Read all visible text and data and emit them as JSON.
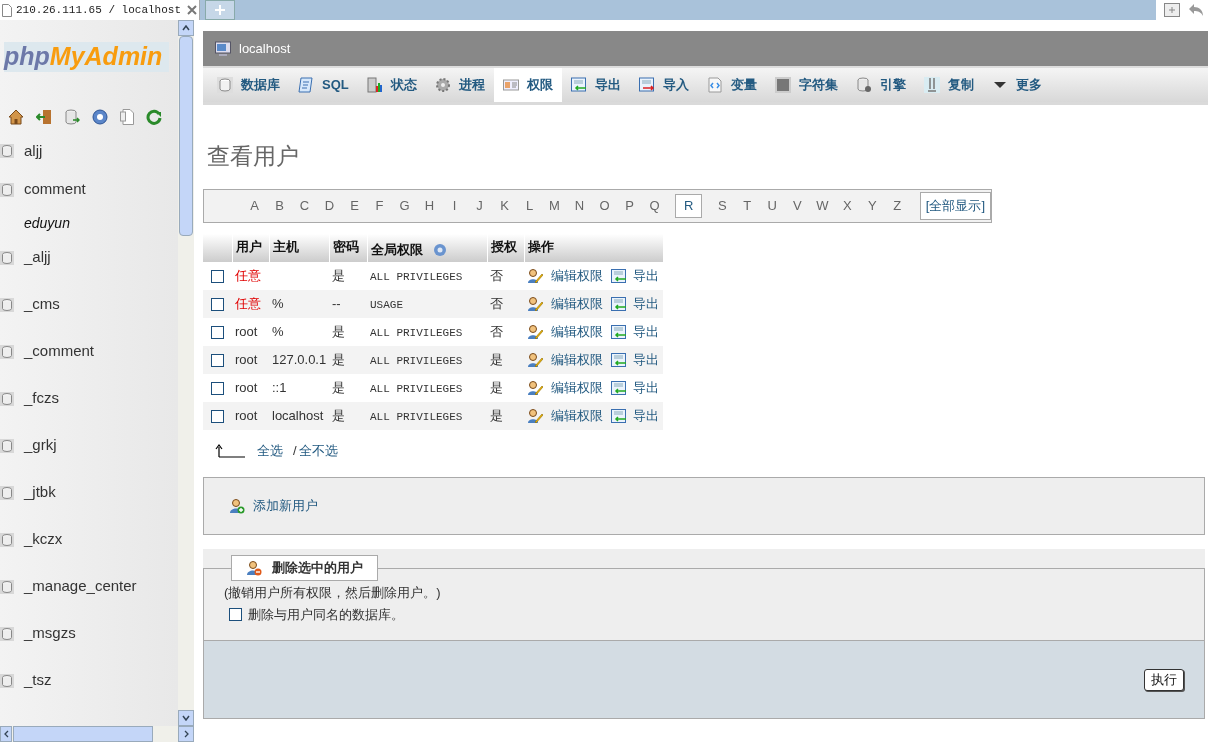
{
  "browser_tab": {
    "title": "210.26.111.65 / localhost"
  },
  "sidebar": {
    "logo": {
      "part_1": "php",
      "part_2": "MyAdmin"
    },
    "items": [
      {
        "name": "aljj"
      },
      {
        "name": "comment"
      },
      {
        "name": "eduyun",
        "children": [
          {
            "name": "_aljj"
          },
          {
            "name": "_cms"
          },
          {
            "name": "_comment"
          },
          {
            "name": "_fczs"
          },
          {
            "name": "_grkj"
          },
          {
            "name": "_jtbk"
          },
          {
            "name": "_kczx"
          },
          {
            "name": "_manage_center"
          },
          {
            "name": "_msgzs"
          },
          {
            "name": "_tsz"
          }
        ]
      }
    ]
  },
  "server": {
    "title": "localhost"
  },
  "nav_tabs": [
    {
      "label": "数据库",
      "selected": false
    },
    {
      "label": "SQL",
      "selected": false
    },
    {
      "label": "状态",
      "selected": false
    },
    {
      "label": "进程",
      "selected": false
    },
    {
      "label": "权限",
      "selected": true
    },
    {
      "label": "导出",
      "selected": false
    },
    {
      "label": "导入",
      "selected": false
    },
    {
      "label": "变量",
      "selected": false
    },
    {
      "label": "字符集",
      "selected": false
    },
    {
      "label": "引擎",
      "selected": false
    },
    {
      "label": "复制",
      "selected": false
    },
    {
      "label": "更多",
      "selected": false
    }
  ],
  "page_title": "查看用户",
  "letters": [
    {
      "label": "A",
      "selected": false
    },
    {
      "label": "B",
      "selected": false
    },
    {
      "label": "C",
      "selected": false
    },
    {
      "label": "D",
      "selected": false
    },
    {
      "label": "E",
      "selected": false
    },
    {
      "label": "F",
      "selected": false
    },
    {
      "label": "G",
      "selected": false
    },
    {
      "label": "H",
      "selected": false
    },
    {
      "label": "I",
      "selected": false
    },
    {
      "label": "J",
      "selected": false
    },
    {
      "label": "K",
      "selected": false
    },
    {
      "label": "L",
      "selected": false
    },
    {
      "label": "M",
      "selected": false
    },
    {
      "label": "N",
      "selected": false
    },
    {
      "label": "O",
      "selected": false
    },
    {
      "label": "P",
      "selected": false
    },
    {
      "label": "Q",
      "selected": false
    },
    {
      "label": "R",
      "selected": true
    },
    {
      "label": "S",
      "selected": false
    },
    {
      "label": "T",
      "selected": false
    },
    {
      "label": "U",
      "selected": false
    },
    {
      "label": "V",
      "selected": false
    },
    {
      "label": "W",
      "selected": false
    },
    {
      "label": "X",
      "selected": false
    },
    {
      "label": "Y",
      "selected": false
    },
    {
      "label": "Z",
      "selected": false
    }
  ],
  "show_all": "[全部显示]",
  "table": {
    "columns": [
      "用户",
      "主机",
      "密码",
      "全局权限",
      "授权",
      "操作"
    ],
    "rows": [
      {
        "checked": false,
        "user": "任意",
        "anonymous": true,
        "host": "",
        "password": "是",
        "privileges": "ALL PRIVILEGES",
        "grant": "否",
        "edit": "编辑权限",
        "export": "导出"
      },
      {
        "checked": false,
        "user": "任意",
        "anonymous": true,
        "host": "%",
        "password": "--",
        "privileges": "USAGE",
        "grant": "否",
        "edit": "编辑权限",
        "export": "导出"
      },
      {
        "checked": false,
        "user": "root",
        "anonymous": false,
        "host": "%",
        "password": "是",
        "privileges": "ALL PRIVILEGES",
        "grant": "否",
        "edit": "编辑权限",
        "export": "导出"
      },
      {
        "checked": false,
        "user": "root",
        "anonymous": false,
        "host": "127.0.0.1",
        "password": "是",
        "privileges": "ALL PRIVILEGES",
        "grant": "是",
        "edit": "编辑权限",
        "export": "导出"
      },
      {
        "checked": false,
        "user": "root",
        "anonymous": false,
        "host": "::1",
        "password": "是",
        "privileges": "ALL PRIVILEGES",
        "grant": "是",
        "edit": "编辑权限",
        "export": "导出"
      },
      {
        "checked": false,
        "user": "root",
        "anonymous": false,
        "host": "localhost",
        "password": "是",
        "privileges": "ALL PRIVILEGES",
        "grant": "是",
        "edit": "编辑权限",
        "export": "导出"
      }
    ]
  },
  "select_all": "全选",
  "separator": "/",
  "select_none": "全不选",
  "add_user": "添加新用户",
  "delete_section": {
    "legend": "删除选中的用户",
    "description": "(撤销用户所有权限，然后删除用户。)",
    "drop_db": {
      "label": "删除与用户同名的数据库。",
      "checked": false
    },
    "submit": "执行"
  }
}
